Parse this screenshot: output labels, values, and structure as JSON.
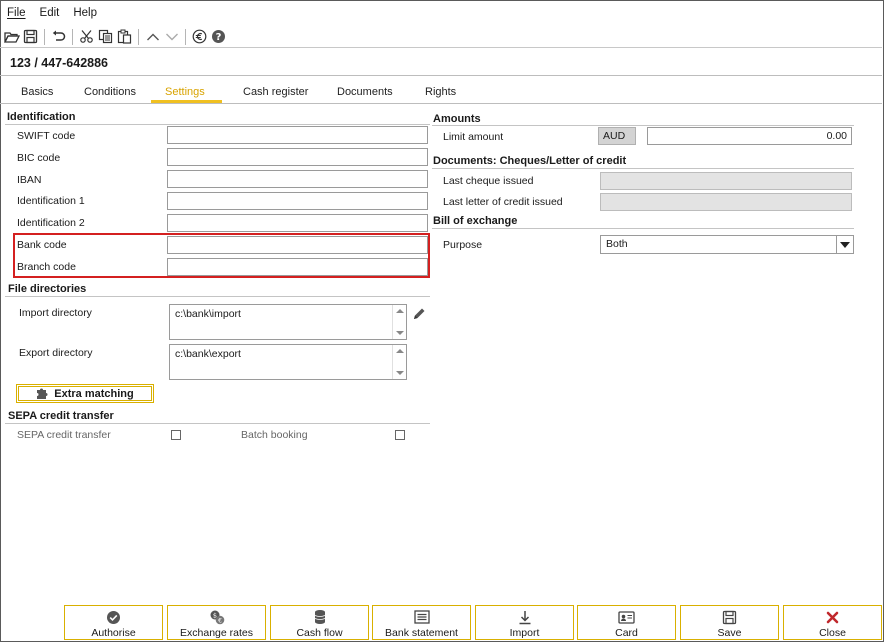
{
  "menu": {
    "file": "File",
    "edit": "Edit",
    "help": "Help"
  },
  "toolbar_icons": [
    "open-icon",
    "save-icon",
    "undo-icon",
    "cut-icon",
    "copy-icon",
    "paste-icon",
    "up-icon",
    "down-icon",
    "euro-icon",
    "help-icon"
  ],
  "record_title": "123 / 447-642886",
  "tabs": [
    {
      "label": "Basics"
    },
    {
      "label": "Conditions"
    },
    {
      "label": "Settings",
      "active": true
    },
    {
      "label": "Cash register"
    },
    {
      "label": "Documents"
    },
    {
      "label": "Rights"
    }
  ],
  "identification": {
    "title": "Identification",
    "swift": {
      "label": "SWIFT code",
      "value": ""
    },
    "bic": {
      "label": "BIC code",
      "value": ""
    },
    "iban": {
      "label": "IBAN",
      "value": ""
    },
    "id1": {
      "label": "Identification 1",
      "value": ""
    },
    "id2": {
      "label": "Identification 2",
      "value": ""
    },
    "bank_code": {
      "label": "Bank code",
      "value": ""
    },
    "branch_code": {
      "label": "Branch code",
      "value": ""
    }
  },
  "file_directories": {
    "title": "File directories",
    "import": {
      "label": "Import directory",
      "value": "c:\\bank\\import"
    },
    "export": {
      "label": "Export directory",
      "value": "c:\\bank\\export"
    },
    "extra_matching": "Extra matching"
  },
  "sepa": {
    "title": "SEPA credit transfer",
    "credit_transfer": {
      "label": "SEPA credit transfer",
      "checked": false
    },
    "batch_booking": {
      "label": "Batch booking",
      "checked": false
    }
  },
  "amounts": {
    "title": "Amounts",
    "limit_label": "Limit amount",
    "currency": "AUD",
    "limit_value": "0.00"
  },
  "documents": {
    "title": "Documents: Cheques/Letter of credit",
    "last_cheque": "Last cheque issued",
    "last_letter": "Last letter of credit issued"
  },
  "bill": {
    "title": "Bill of exchange",
    "purpose_label": "Purpose",
    "purpose_value": "Both"
  },
  "bottom_buttons": [
    {
      "label": "Authorise",
      "icon": "check-circle-icon"
    },
    {
      "label": "Exchange rates",
      "icon": "exchange-icon"
    },
    {
      "label": "Cash flow",
      "icon": "coins-icon"
    },
    {
      "label": "Bank statement",
      "icon": "statement-icon"
    },
    {
      "label": "Import",
      "icon": "import-icon"
    },
    {
      "label": "Card",
      "icon": "card-icon"
    },
    {
      "label": "Save",
      "icon": "save-icon"
    },
    {
      "label": "Close",
      "icon": "close-icon"
    }
  ],
  "colors": {
    "accent": "#d9b000",
    "highlight": "#d42020",
    "close": "#c0282c"
  }
}
